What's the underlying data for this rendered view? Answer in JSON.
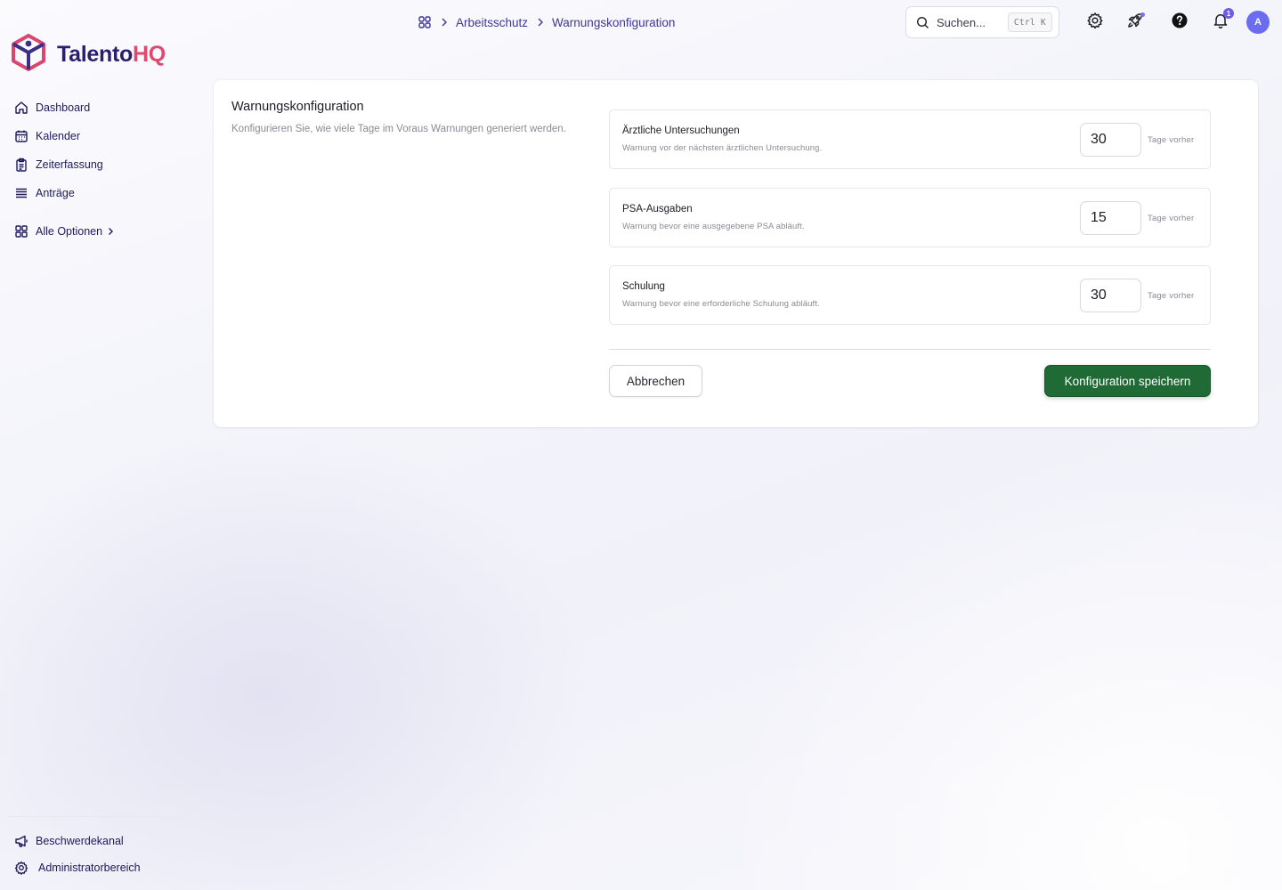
{
  "brand": {
    "name_main": "Talento",
    "name_accent": "HQ"
  },
  "sidebar": {
    "items": [
      {
        "label": "Dashboard",
        "icon": "home-icon"
      },
      {
        "label": "Kalender",
        "icon": "calendar-icon"
      },
      {
        "label": "Zeiterfassung",
        "icon": "clipboard-icon"
      },
      {
        "label": "Anträge",
        "icon": "stack-icon"
      }
    ],
    "all_options": {
      "label": "Alle Optionen",
      "icon": "grid-icon"
    },
    "bottom_items": [
      {
        "label": "Beschwerdekanal",
        "icon": "megaphone-icon"
      },
      {
        "label": "Administratorbereich",
        "icon": "gear-icon"
      }
    ]
  },
  "breadcrumb": {
    "home_icon": "grid-icon",
    "items": [
      "Arbeitsschutz",
      "Warnungskonfiguration"
    ]
  },
  "search": {
    "placeholder": "Suchen...",
    "shortcut": "Ctrl K"
  },
  "topbar": {
    "icons": [
      "gear-icon",
      "rocket-icon",
      "help-icon",
      "bell-icon"
    ],
    "notification_count": "1",
    "avatar_initial": "A",
    "accent_color": "#6b6cf0"
  },
  "page": {
    "title": "Warnungskonfiguration",
    "description": "Konfigurieren Sie, wie viele Tage im Voraus Warnungen generiert werden.",
    "settings": [
      {
        "title": "Ärztliche Untersuchungen",
        "description": "Warnung vor der nächsten ärztlichen Untersuchung.",
        "value": "30",
        "unit": "Tage vorher"
      },
      {
        "title": "PSA-Ausgaben",
        "description": "Warnung bevor eine ausgegebene PSA abläuft.",
        "value": "15",
        "unit": "Tage vorher"
      },
      {
        "title": "Schulung",
        "description": "Warnung bevor eine erforderliche Schulung abläuft.",
        "value": "30",
        "unit": "Tage vorher"
      }
    ],
    "cancel_label": "Abbrechen",
    "save_label": "Konfiguration speichern",
    "save_color": "#206b35"
  }
}
